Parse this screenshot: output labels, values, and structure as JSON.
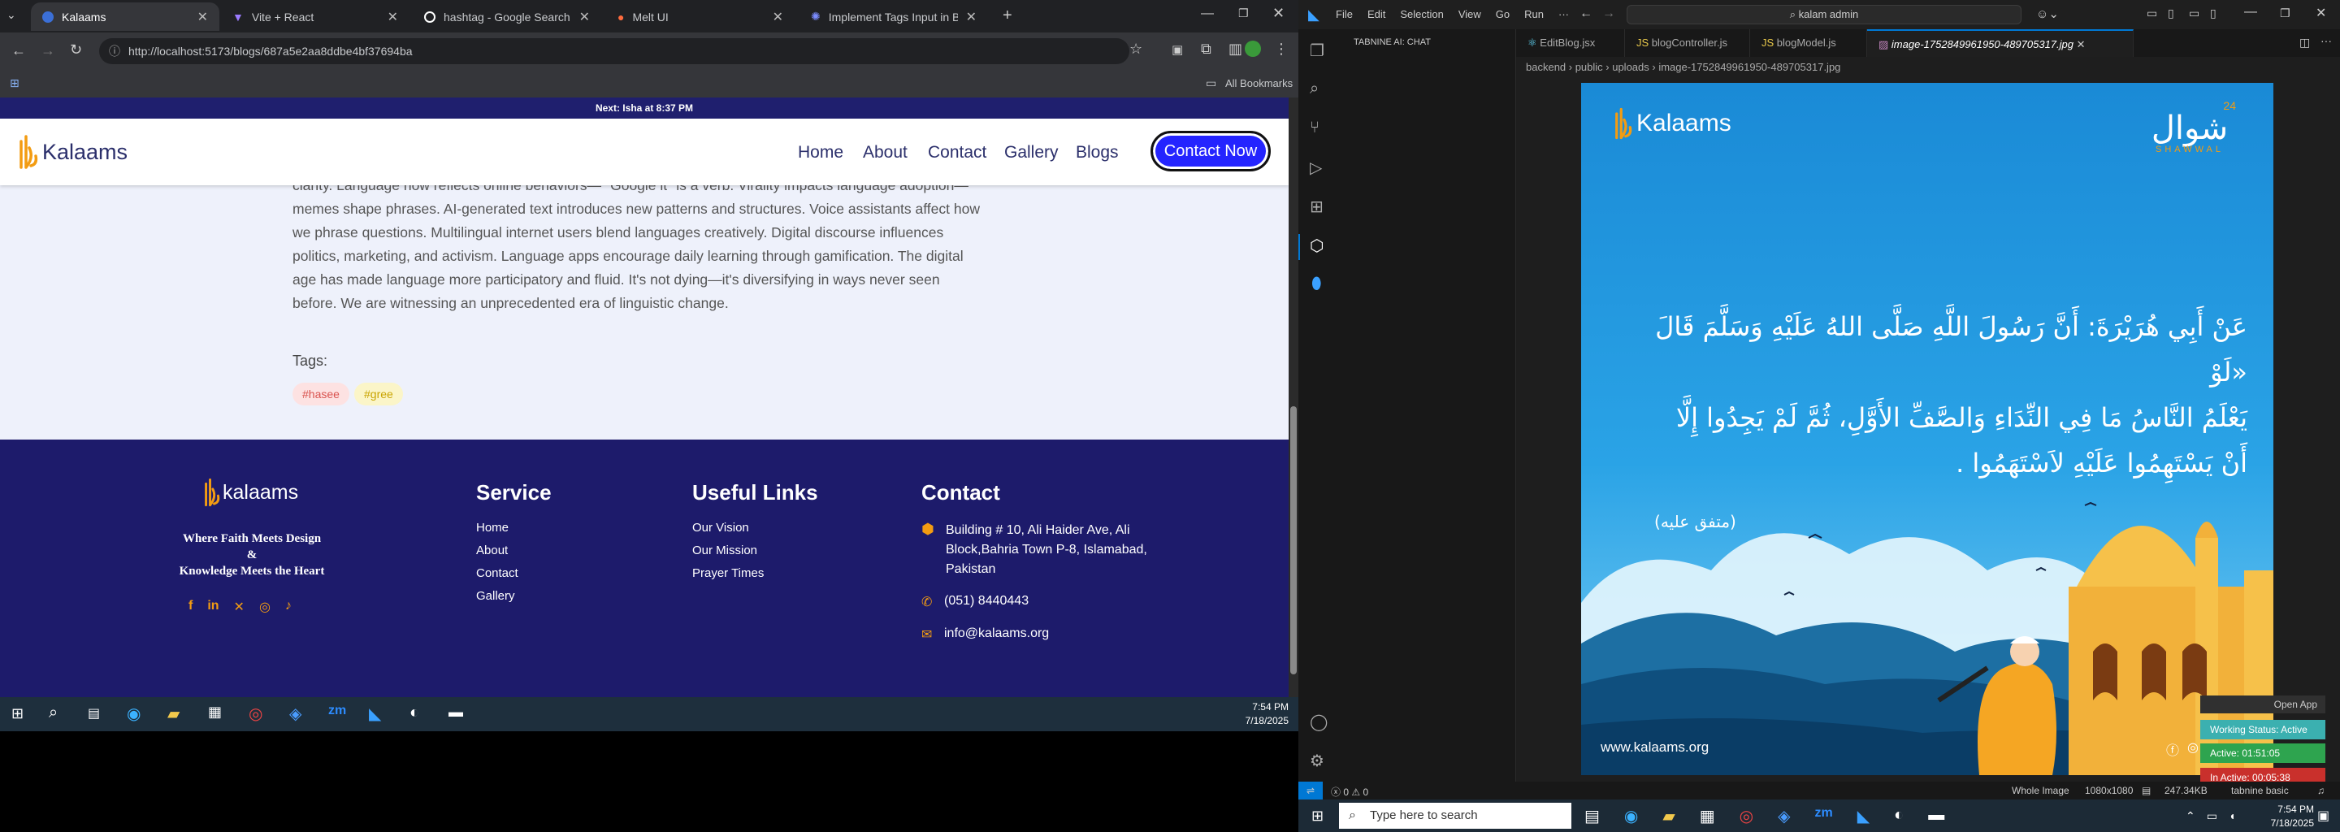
{
  "browser": {
    "tabs": [
      {
        "title": "Kalaams",
        "active": true
      },
      {
        "title": "Vite + React",
        "active": false
      },
      {
        "title": "hashtag - Google Search",
        "active": false
      },
      {
        "title": "Melt UI",
        "active": false
      },
      {
        "title": "Implement Tags Input in Blog I",
        "active": false
      }
    ],
    "url": "http://localhost:5173/blogs/687a5e2aa8ddbe4bf37694ba",
    "bookmarks_label": "All Bookmarks"
  },
  "site": {
    "topbar_text": "Next: Isha at 8:37 PM",
    "logo_text": "Kalaams",
    "nav": [
      "Home",
      "About",
      "Contact",
      "Gallery",
      "Blogs"
    ],
    "contact_button": "Contact Now",
    "article_lines": [
      "clarity. Language now reflects online behaviors— \"Google it\" is a verb. Virality impacts language adoption—",
      "memes shape phrases. AI-generated text introduces new patterns and structures. Voice assistants affect how",
      "we phrase questions. Multilingual internet users blend languages creatively. Digital discourse influences",
      "politics, marketing, and activism. Language apps encourage daily learning through gamification. The digital",
      "age has made language more participatory and fluid. It's not dying—it's diversifying in ways never seen",
      "before. We are witnessing an unprecedented era of linguistic change."
    ],
    "tags_label": "Tags:",
    "tags": [
      "#hasee",
      "#gree"
    ],
    "footer": {
      "logo_text": "kalaams",
      "tagline": [
        "Where Faith Meets Design",
        "&",
        "Knowledge Meets the Heart"
      ],
      "service_heading": "Service",
      "service_links": [
        "Home",
        "About",
        "Contact",
        "Gallery"
      ],
      "useful_heading": "Useful Links",
      "useful_links": [
        "Our Vision",
        "Our Mission",
        "Prayer Times"
      ],
      "contact_heading": "Contact",
      "address": [
        "Building # 10, Ali Haider Ave, Ali",
        "Block,Bahria Town P-8, Islamabad,",
        "Pakistan"
      ],
      "phone": "(051) 8440443",
      "email": "info@kalaams.org"
    }
  },
  "taskbar_left": {
    "time": "7:54 PM",
    "date": "7/18/2025"
  },
  "vscode": {
    "menu": [
      "File",
      "Edit",
      "Selection",
      "View",
      "Go",
      "Run",
      "···"
    ],
    "search": "kalam admin",
    "sidebar_title": "TABNINE AI: CHAT",
    "editor_tabs": [
      "EditBlog.jsx",
      "blogController.js",
      "blogModel.js",
      "image-1752849961950-489705317.jpg"
    ],
    "breadcrumb": "backend › public › uploads › image-1752849961950-489705317.jpg",
    "image": {
      "logo_text": "Kalaams",
      "shawwal_arabic": "شوال",
      "shawwal_number": "24",
      "shawwal_label": "SHAWWAL",
      "hadith_lines": [
        "عَنْ أَبِي هُرَيْرَةَ: أَنَّ رَسُولَ اللَّهِ صَلَّى اللهُ عَلَيْهِ وَسَلَّمَ قَالَ «لَوْ",
        "يَعْلَمُ النَّاسُ مَا فِي النِّدَاءِ وَالصَّفِّ الأَوَّلِ، ثُمَّ لَمْ يَجِدُوا إِلَّا",
        "أَنْ يَسْتَهِمُوا عَلَيْهِ لاَسْتَهَمُوا ."
      ],
      "attribution": "(متفق عليه)",
      "website": "www.kalaams.org"
    },
    "status": {
      "problems": "0",
      "warnings": "0",
      "image_mode": "Whole Image",
      "dimensions": "1080x1080",
      "size": "247.34KB",
      "tabnine": "tabnine basic"
    },
    "tracker": {
      "open_app": "Open App",
      "working": "Working Status: Active",
      "active": "Active: 01:51:05",
      "inactive": "In Active: 00:05:38"
    }
  },
  "taskbar_right": {
    "search_placeholder": "Type here to search",
    "time": "7:54 PM",
    "date": "7/18/2025"
  }
}
